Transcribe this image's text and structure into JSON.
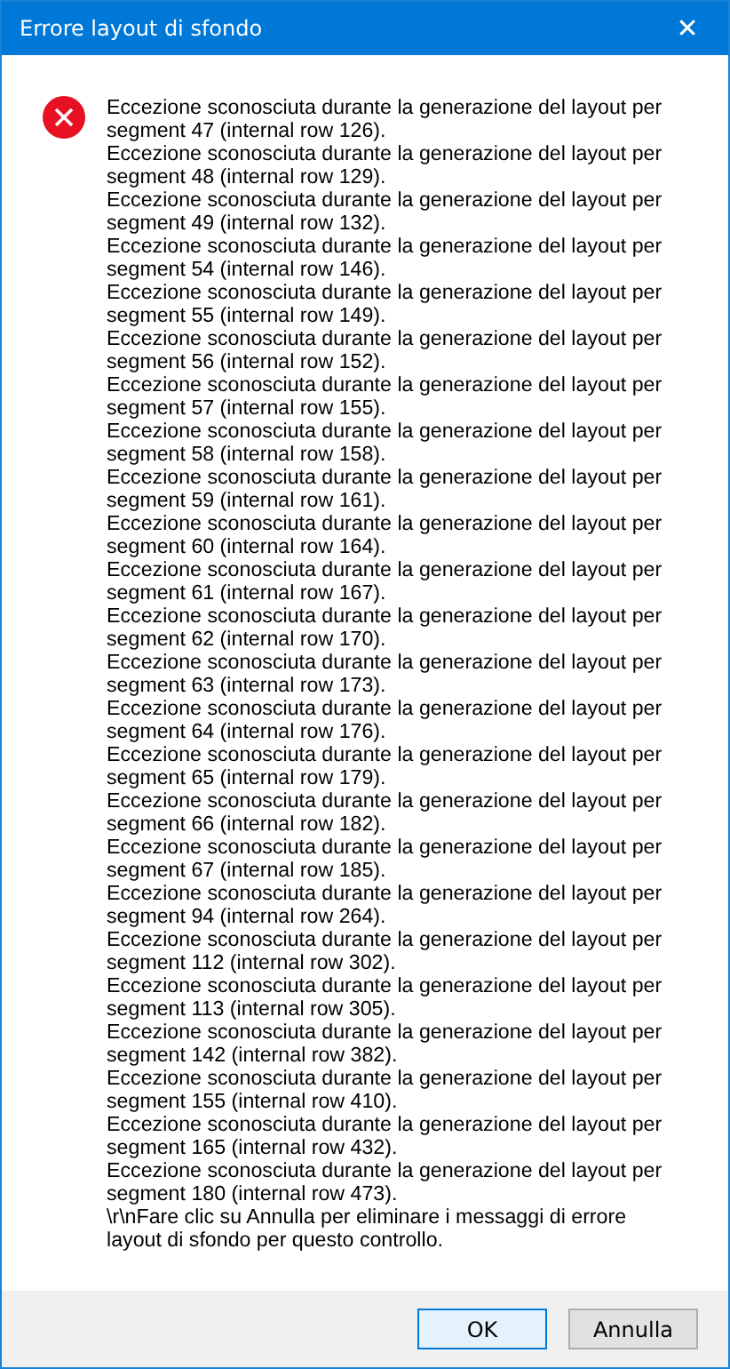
{
  "window": {
    "title": "Errore layout di sfondo",
    "close_glyph": "✕"
  },
  "message": {
    "entries": [
      "Eccezione sconosciuta durante la generazione del layout per\nsegment 47 (internal row 126).",
      "Eccezione sconosciuta durante la generazione del layout per\nsegment 48 (internal row 129).",
      "Eccezione sconosciuta durante la generazione del layout per\nsegment 49 (internal row 132).",
      "Eccezione sconosciuta durante la generazione del layout per\nsegment 54 (internal row 146).",
      "Eccezione sconosciuta durante la generazione del layout per\nsegment 55 (internal row 149).",
      "Eccezione sconosciuta durante la generazione del layout per\nsegment 56 (internal row 152).",
      "Eccezione sconosciuta durante la generazione del layout per\nsegment 57 (internal row 155).",
      "Eccezione sconosciuta durante la generazione del layout per\nsegment 58 (internal row 158).",
      "Eccezione sconosciuta durante la generazione del layout per\nsegment 59 (internal row 161).",
      "Eccezione sconosciuta durante la generazione del layout per\nsegment 60 (internal row 164).",
      "Eccezione sconosciuta durante la generazione del layout per\nsegment 61 (internal row 167).",
      "Eccezione sconosciuta durante la generazione del layout per\nsegment 62 (internal row 170).",
      "Eccezione sconosciuta durante la generazione del layout per\nsegment 63 (internal row 173).",
      "Eccezione sconosciuta durante la generazione del layout per\nsegment 64 (internal row 176).",
      "Eccezione sconosciuta durante la generazione del layout per\nsegment 65 (internal row 179).",
      "Eccezione sconosciuta durante la generazione del layout per\nsegment 66 (internal row 182).",
      "Eccezione sconosciuta durante la generazione del layout per\nsegment 67 (internal row 185).",
      "Eccezione sconosciuta durante la generazione del layout per\nsegment 94 (internal row 264).",
      "Eccezione sconosciuta durante la generazione del layout per\nsegment 112 (internal row 302).",
      "Eccezione sconosciuta durante la generazione del layout per\nsegment 113 (internal row 305).",
      "Eccezione sconosciuta durante la generazione del layout per\nsegment 142 (internal row 382).",
      "Eccezione sconosciuta durante la generazione del layout per\nsegment 155 (internal row 410).",
      "Eccezione sconosciuta durante la generazione del layout per\nsegment 165 (internal row 432).",
      "Eccezione sconosciuta durante la generazione del layout per\nsegment 180 (internal row 473)."
    ],
    "footer_note": "\\r\\nFare clic su Annulla per eliminare i messaggi di errore\nlayout di sfondo per questo controllo."
  },
  "buttons": [
    {
      "label": "OK",
      "default": true
    },
    {
      "label": "Annulla",
      "default": false
    }
  ]
}
